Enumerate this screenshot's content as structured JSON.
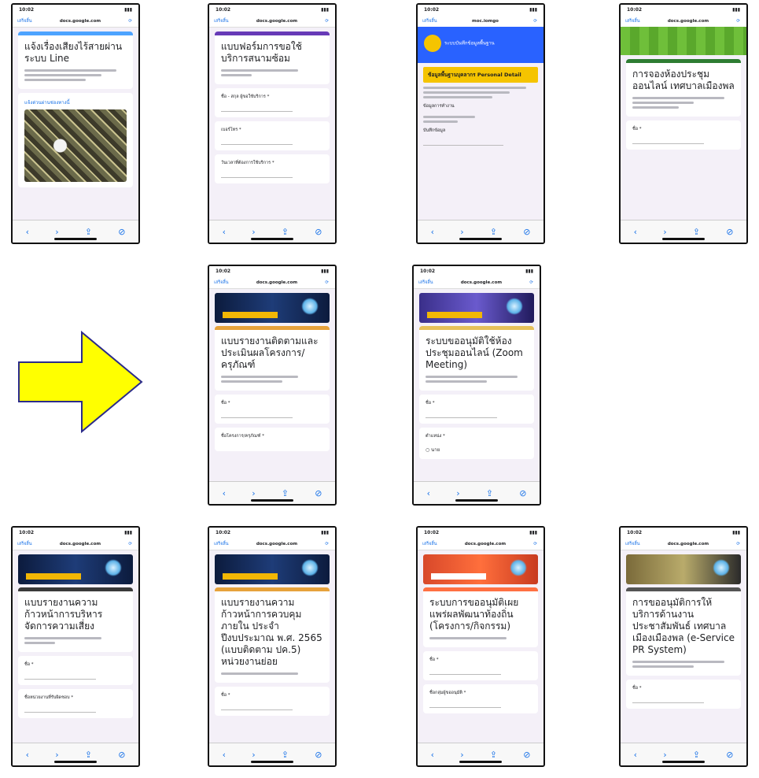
{
  "common": {
    "time": "10:02",
    "back_label": "เสร็จสิ้น",
    "url": "docs.google.com",
    "aa": "AA"
  },
  "phones": [
    {
      "id": "p1",
      "title": "แจ้งเรื่องเสียงไร้สายผ่านระบบ Line",
      "link": "แจ้งด่วนผ่านช่องทางนี้"
    },
    {
      "id": "p2",
      "title": "แบบฟอร์มการขอใช้บริการสนามซ้อม",
      "q1": "ชื่อ - สกุล ผู้ขอใช้บริการ *",
      "q2": "เบอร์โทร *",
      "q3": "วันเวลาที่ต้องการใช้บริการ *"
    },
    {
      "id": "p3",
      "head": "ระบบบันทึกข้อมูลพื้นฐาน",
      "yellow": "ข้อมูลพื้นฐานบุคลากร Personal Detail",
      "s1": "ข้อมูลการทำงาน",
      "s2": "บันทึกข้อมูล"
    },
    {
      "id": "p4",
      "title": "การจองห้องประชุมออนไลน์ เทศบาลเมืองพล",
      "q1": "ชื่อ *"
    },
    {
      "id": "p5",
      "title": "แบบรายงานติดตามและประเมินผลโครงการ/ครุภัณฑ์",
      "q1": "ชื่อ *",
      "q2": "ชื่อโครงการ/ครุภัณฑ์ *"
    },
    {
      "id": "p6",
      "title": "ระบบขออนุมัติใช้ห้องประชุมออนไลน์ (Zoom Meeting)",
      "q1": "ชื่อ *",
      "q2": "ตำแหน่ง *",
      "opt": "นาย"
    },
    {
      "id": "p7",
      "title": "แบบรายงานความก้าวหน้าการบริหารจัดการความเสี่ยง",
      "q1": "ชื่อ *",
      "q2": "ชื่อหน่วยงานที่รับผิดชอบ *"
    },
    {
      "id": "p8",
      "title": "แบบรายงานความก้าวหน้าการควบคุมภายใน ประจำปีงบประมาณ พ.ศ. 2565 (แบบติดตาม ปค.5) หน่วยงานย่อย",
      "q1": "ชื่อ *"
    },
    {
      "id": "p9",
      "title": "ระบบการขออนุมัติเผยแพร่ผลพัฒนาท้องถิ่น (โครงการ/กิจกรรม)",
      "q1": "ชื่อ *",
      "q2": "ชื่อกลุ่มผู้ขออนุมัติ *"
    },
    {
      "id": "p10",
      "title": "การขออนุมัติการให้บริการด้านงานประชาสัมพันธ์ เทศบาลเมืองเมืองพล (e-Service PR System)",
      "q1": "ชื่อ *"
    }
  ]
}
